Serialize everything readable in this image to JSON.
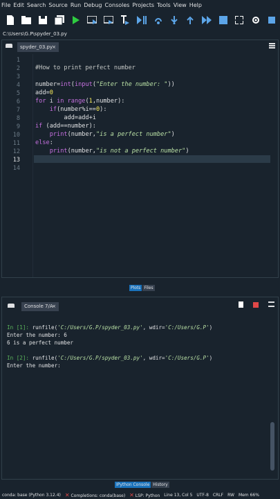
{
  "menu": [
    "File",
    "Edit",
    "Search",
    "Source",
    "Run",
    "Debug",
    "Consoles",
    "Projects",
    "Tools",
    "View",
    "Help"
  ],
  "toolbar": {
    "icons": [
      "new-file-icon",
      "open-folder-icon",
      "save-icon",
      "save-all-icon",
      "run-icon",
      "run-cell-icon",
      "run-cell-advance-icon",
      "run-selection-icon",
      "debug-icon",
      "step-icon",
      "step-into-icon",
      "step-return-icon",
      "continue-icon",
      "stop-debug-icon",
      "maximize-icon",
      "settings-icon",
      "python-path-icon"
    ],
    "colors": {
      "run": "#2ecc40",
      "accent": "#5ca5e8",
      "stop": "#e04848",
      "doc": "#ffffff"
    }
  },
  "path": "C:\\Users\\G.P\\spyder_03.py",
  "editor": {
    "tab_label": "spyder_03.py",
    "tab_close": "×",
    "current_line": 13,
    "lines": [
      {
        "n": 1,
        "text": ""
      },
      {
        "n": 2,
        "text": "#How to print perfect number"
      },
      {
        "n": 3,
        "text": ""
      },
      {
        "n": 4,
        "text": "number=int(input(\"Enter the number: \"))"
      },
      {
        "n": 5,
        "text": "add=0"
      },
      {
        "n": 6,
        "text": "for i in range(1,number):"
      },
      {
        "n": 7,
        "text": "    if(number%i==0):"
      },
      {
        "n": 8,
        "text": "        add=add+i"
      },
      {
        "n": 9,
        "text": "if (add==number):"
      },
      {
        "n": 10,
        "text": "    print(number,\"is a perfect number\")"
      },
      {
        "n": 11,
        "text": "else:"
      },
      {
        "n": 12,
        "text": "    print(number,\"is not a perfect number\")"
      },
      {
        "n": 13,
        "text": ""
      },
      {
        "n": 14,
        "text": ""
      }
    ]
  },
  "panes_tabs": [
    "Plots",
    "Files"
  ],
  "console": {
    "tab_label": "Console 7/A",
    "tab_close": "×",
    "lines": [
      {
        "prompt": "In [1]:",
        "cmd": "runfile(",
        "s1": "'C:/Users/G.P/spyder_03.py'",
        "mid": ", wdir=",
        "s2": "'C:/Users/G.P'",
        "end": ")"
      },
      {
        "text": "Enter the number: 6"
      },
      {
        "text": "6 is a perfect number"
      },
      {
        "text": ""
      },
      {
        "prompt": "In [2]:",
        "cmd": "runfile(",
        "s1": "'C:/Users/G.P/spyder_03.py'",
        "mid": ", wdir=",
        "s2": "'C:/Users/G.P'",
        "end": ")"
      },
      {
        "text": "Enter the number:"
      }
    ]
  },
  "bottom_tabs": [
    "IPython Console",
    "History"
  ],
  "status": {
    "conda": "conda: base (Python 3.12.4)",
    "completions": "Completions: conda(base)",
    "lsp": "LSP: Python",
    "position": "Line 13, Col 5",
    "encoding": "UTF-8",
    "eol": "CRLF",
    "rw": "RW",
    "mem": "Mem 66%"
  }
}
